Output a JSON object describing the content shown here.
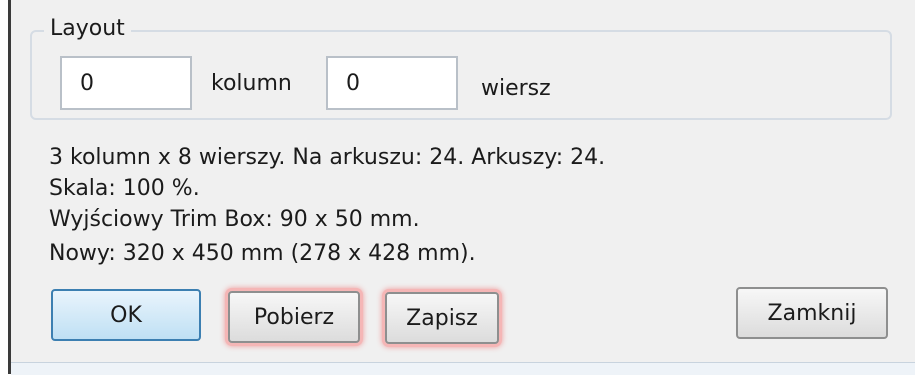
{
  "layout": {
    "title": "Layout",
    "columns_value": "0",
    "columns_label": "kolumn",
    "rows_value": "0",
    "rows_label": "wiersz"
  },
  "info": {
    "line1": "3 kolumn x 8 wierszy. Na arkuszu: 24. Arkuszy: 24.",
    "line2": "Skala: 100 %.",
    "line3": "Wyjściowy Trim Box: 90 x 50 mm.",
    "line4": "Nowy: 320 x 450 mm (278 x 428 mm)."
  },
  "buttons": {
    "ok": "OK",
    "get": "Pobierz",
    "save": "Zapisz",
    "close": "Zamknij"
  }
}
